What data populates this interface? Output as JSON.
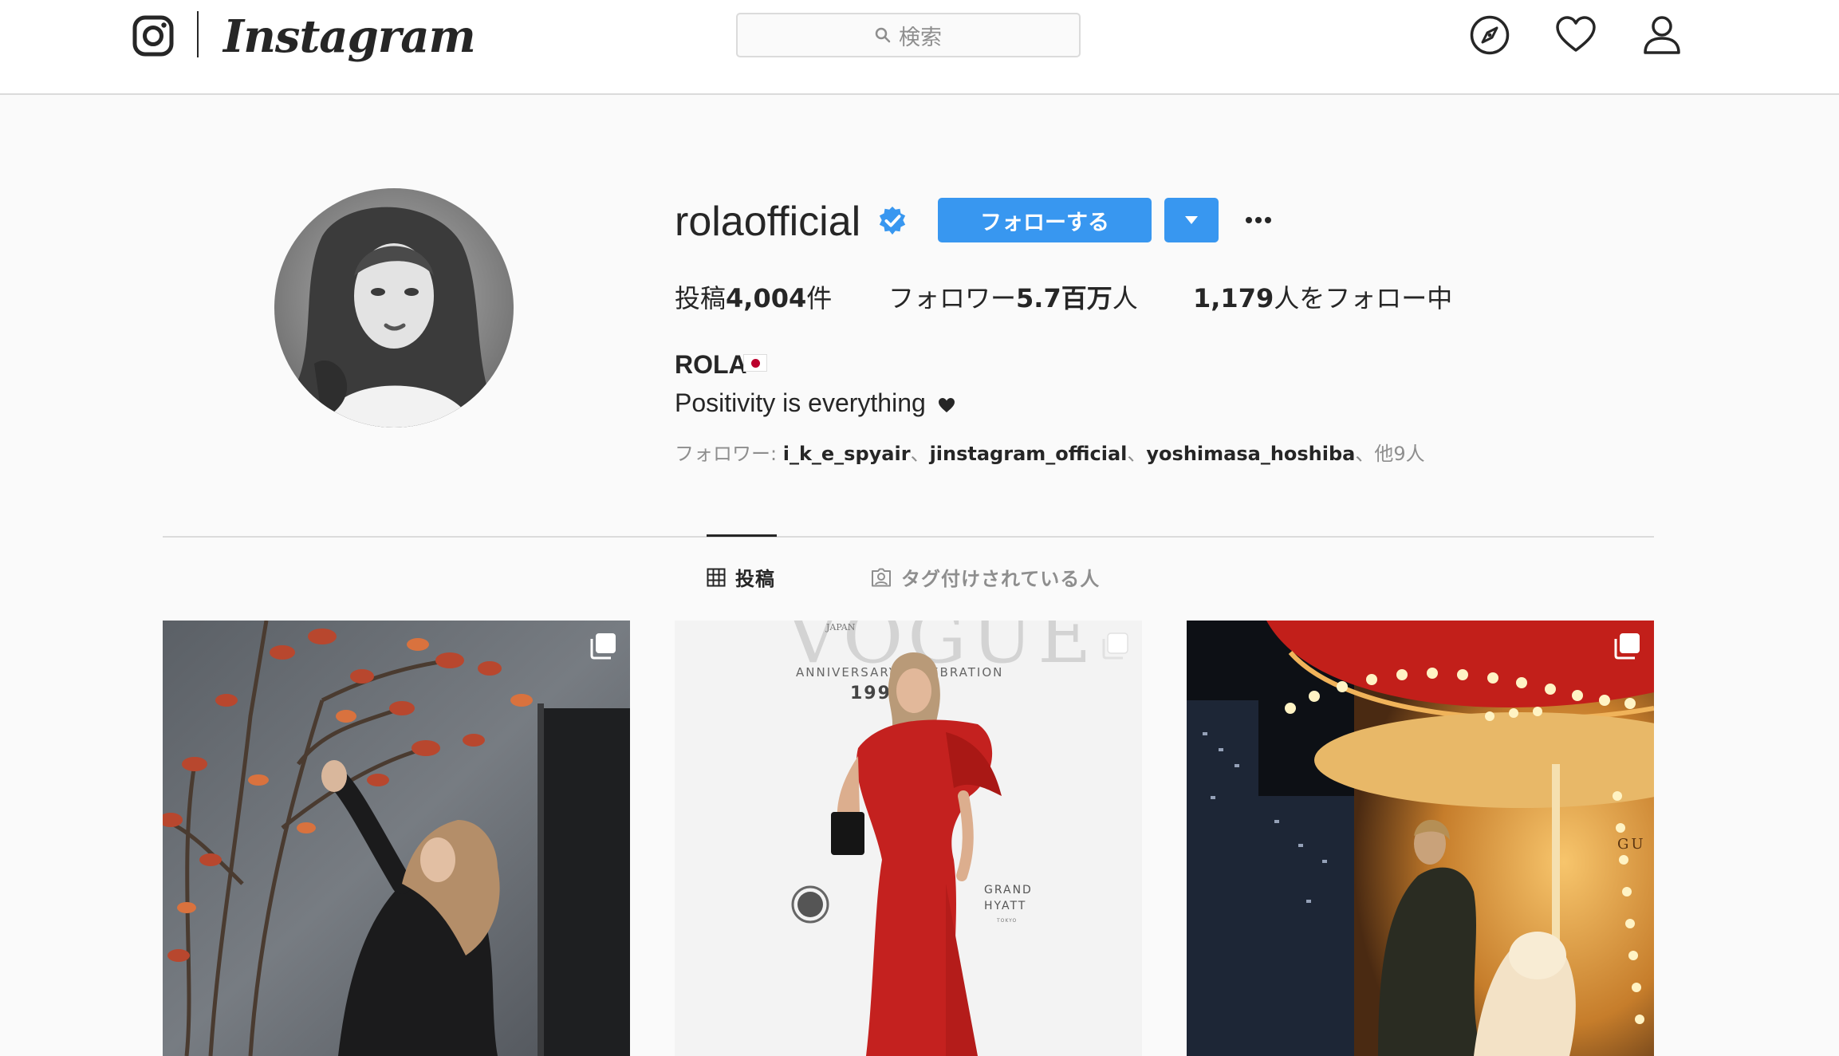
{
  "header": {
    "wordmark": "Instagram",
    "search_placeholder": "検索",
    "icons": [
      "instagram-logo-icon",
      "search-icon",
      "explore-compass-icon",
      "activity-heart-icon",
      "profile-user-icon"
    ]
  },
  "profile": {
    "username": "rolaofficial",
    "verified": true,
    "follow_label": "フォローする",
    "stats": {
      "posts_prefix": "投稿",
      "posts_count": "4,004",
      "posts_suffix": "件",
      "followers_prefix": "フォロワー",
      "followers_count": "5.7百万",
      "followers_suffix": "人",
      "following_count": "1,179",
      "following_suffix": "人をフォロー中"
    },
    "full_name": "ROLA",
    "bio": "Positivity is everything",
    "followed_by": {
      "prefix": "フォロワー: ",
      "names": [
        "i_k_e_spyair",
        "jinstagram_official",
        "yoshimasa_hoshiba"
      ],
      "separator": "、",
      "suffix": "他9人"
    }
  },
  "tabs": [
    {
      "label": "投稿",
      "active": true
    },
    {
      "label": "タグ付けされている人",
      "active": false
    }
  ],
  "posts": [
    {
      "type": "carousel"
    },
    {
      "type": "carousel",
      "text_magazine": "VOGUE",
      "text_japan": "JAPAN",
      "text_anniv": "ANNIVERSARY CELEBRATION",
      "text_year": "1999",
      "text_hotel1": "GRAND",
      "text_hotel2": "HYATT",
      "text_hotel3": "TOKYO"
    },
    {
      "type": "carousel",
      "text_sign": "GU"
    }
  ],
  "colors": {
    "accent": "#3897f0",
    "text": "#262626",
    "muted": "#8e8e8e",
    "border": "#dbdbdb",
    "background": "#fafafa"
  }
}
